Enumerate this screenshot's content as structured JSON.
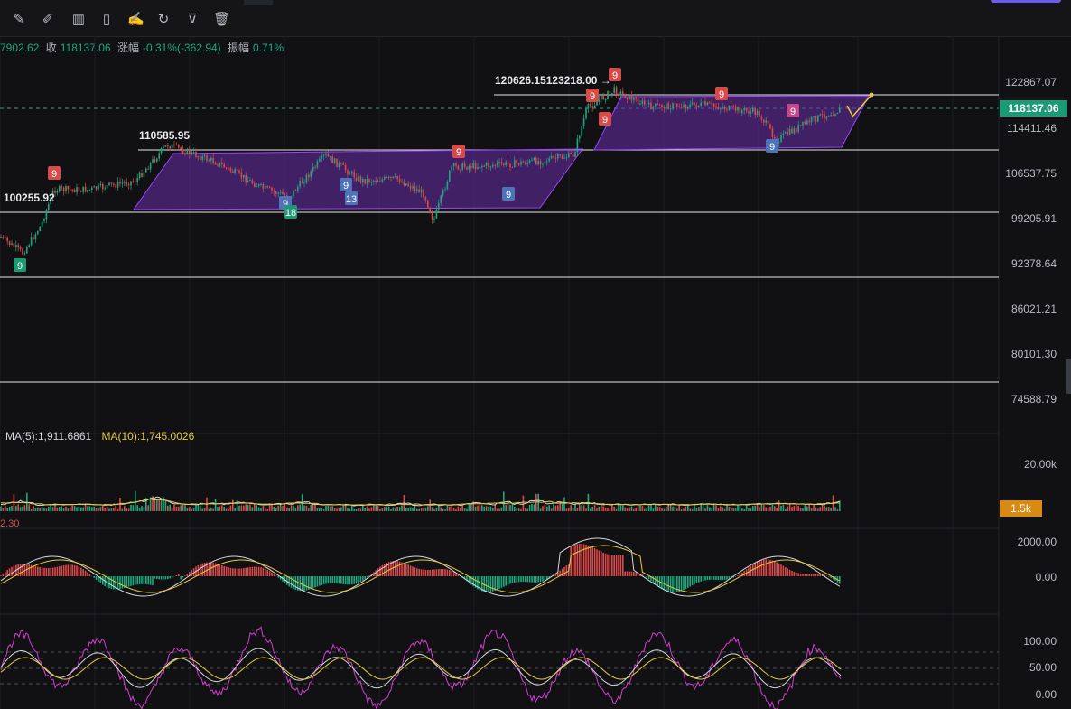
{
  "toolbar": {
    "tools": [
      {
        "icon": "ruler-icon",
        "glyph": "✎"
      },
      {
        "icon": "pen-icon",
        "glyph": "✐"
      },
      {
        "icon": "candlestick-icon",
        "glyph": "▥"
      },
      {
        "icon": "clipboard-icon",
        "glyph": "▯"
      },
      {
        "icon": "edit-note-icon",
        "glyph": "✍"
      },
      {
        "icon": "refresh-icon",
        "glyph": "↻"
      },
      {
        "icon": "filter-icon",
        "glyph": "⊽"
      },
      {
        "icon": "trash-icon",
        "glyph": "🗑"
      }
    ]
  },
  "ohlc": {
    "open_fragment": "7902.62",
    "close_label": "收",
    "close": "118137.06",
    "change_label": "涨幅",
    "change": "-0.31%(-362.94)",
    "amplitude_label": "振幅",
    "amplitude": "0.71%"
  },
  "price_axis": [
    "122867.07",
    "114411.46",
    "106537.75",
    "99205.91",
    "92378.64",
    "86021.21",
    "80101.30",
    "74588.79"
  ],
  "last_price": "118137.06",
  "annotations": {
    "low_1": "100255.92",
    "high_1": "110585.95",
    "high_2": "120626.15",
    "high_3": "123218.00"
  },
  "td_markers": [
    "9",
    "9",
    "9",
    "18",
    "9",
    "13",
    "9",
    "9",
    "9",
    "9",
    "9",
    "9",
    "9",
    "9"
  ],
  "volume": {
    "ma5": "MA(5):1,911.6861",
    "ma10": "MA(10):1,745.0026",
    "axis": "20.00k",
    "current": "1.5k"
  },
  "macd": {
    "label": "2.30",
    "axis": [
      "2000.00",
      "0.00"
    ]
  },
  "kdj": {
    "axis": [
      "100.00",
      "50.00",
      "0.00"
    ]
  },
  "colors": {
    "up": "#1fa77f",
    "down": "#d94a4a",
    "channel_fill": "#6a2ea8",
    "channel_stroke": "#9a45ff",
    "ma5": "#d5d7db",
    "ma10": "#e6cb3d",
    "kdj_j": "#d03fcf"
  }
}
